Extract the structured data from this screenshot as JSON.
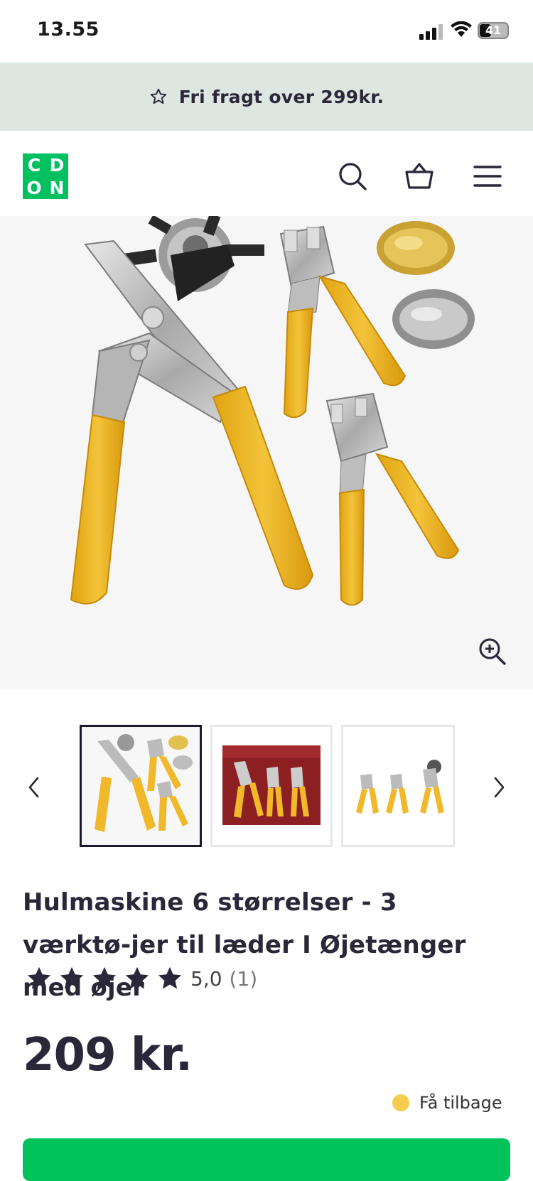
{
  "status_bar": {
    "time": "13.55",
    "battery": "41",
    "battery_level": 0.41
  },
  "promo": {
    "text": "Fri fragt over 299kr."
  },
  "header": {
    "logo_letters": [
      "C",
      "D",
      "O",
      "N"
    ],
    "icons": [
      "search-icon",
      "basket-icon",
      "menu-icon"
    ]
  },
  "gallery": {
    "thumbnail_count": 3,
    "selected_index": 0
  },
  "product": {
    "title": "Hulmaskine 6 størrelser - 3 værktø-jer til læder I Øjetænger med øjer",
    "rating_value": "5,0",
    "rating_count": "(1)",
    "stars": 5,
    "price": "209 kr."
  },
  "cashback": {
    "label": "Få tilbage",
    "color": "#f7cb4d"
  },
  "colors": {
    "brand": "#00c060",
    "promo_bg": "#dde6e0",
    "text": "#2a2838"
  }
}
